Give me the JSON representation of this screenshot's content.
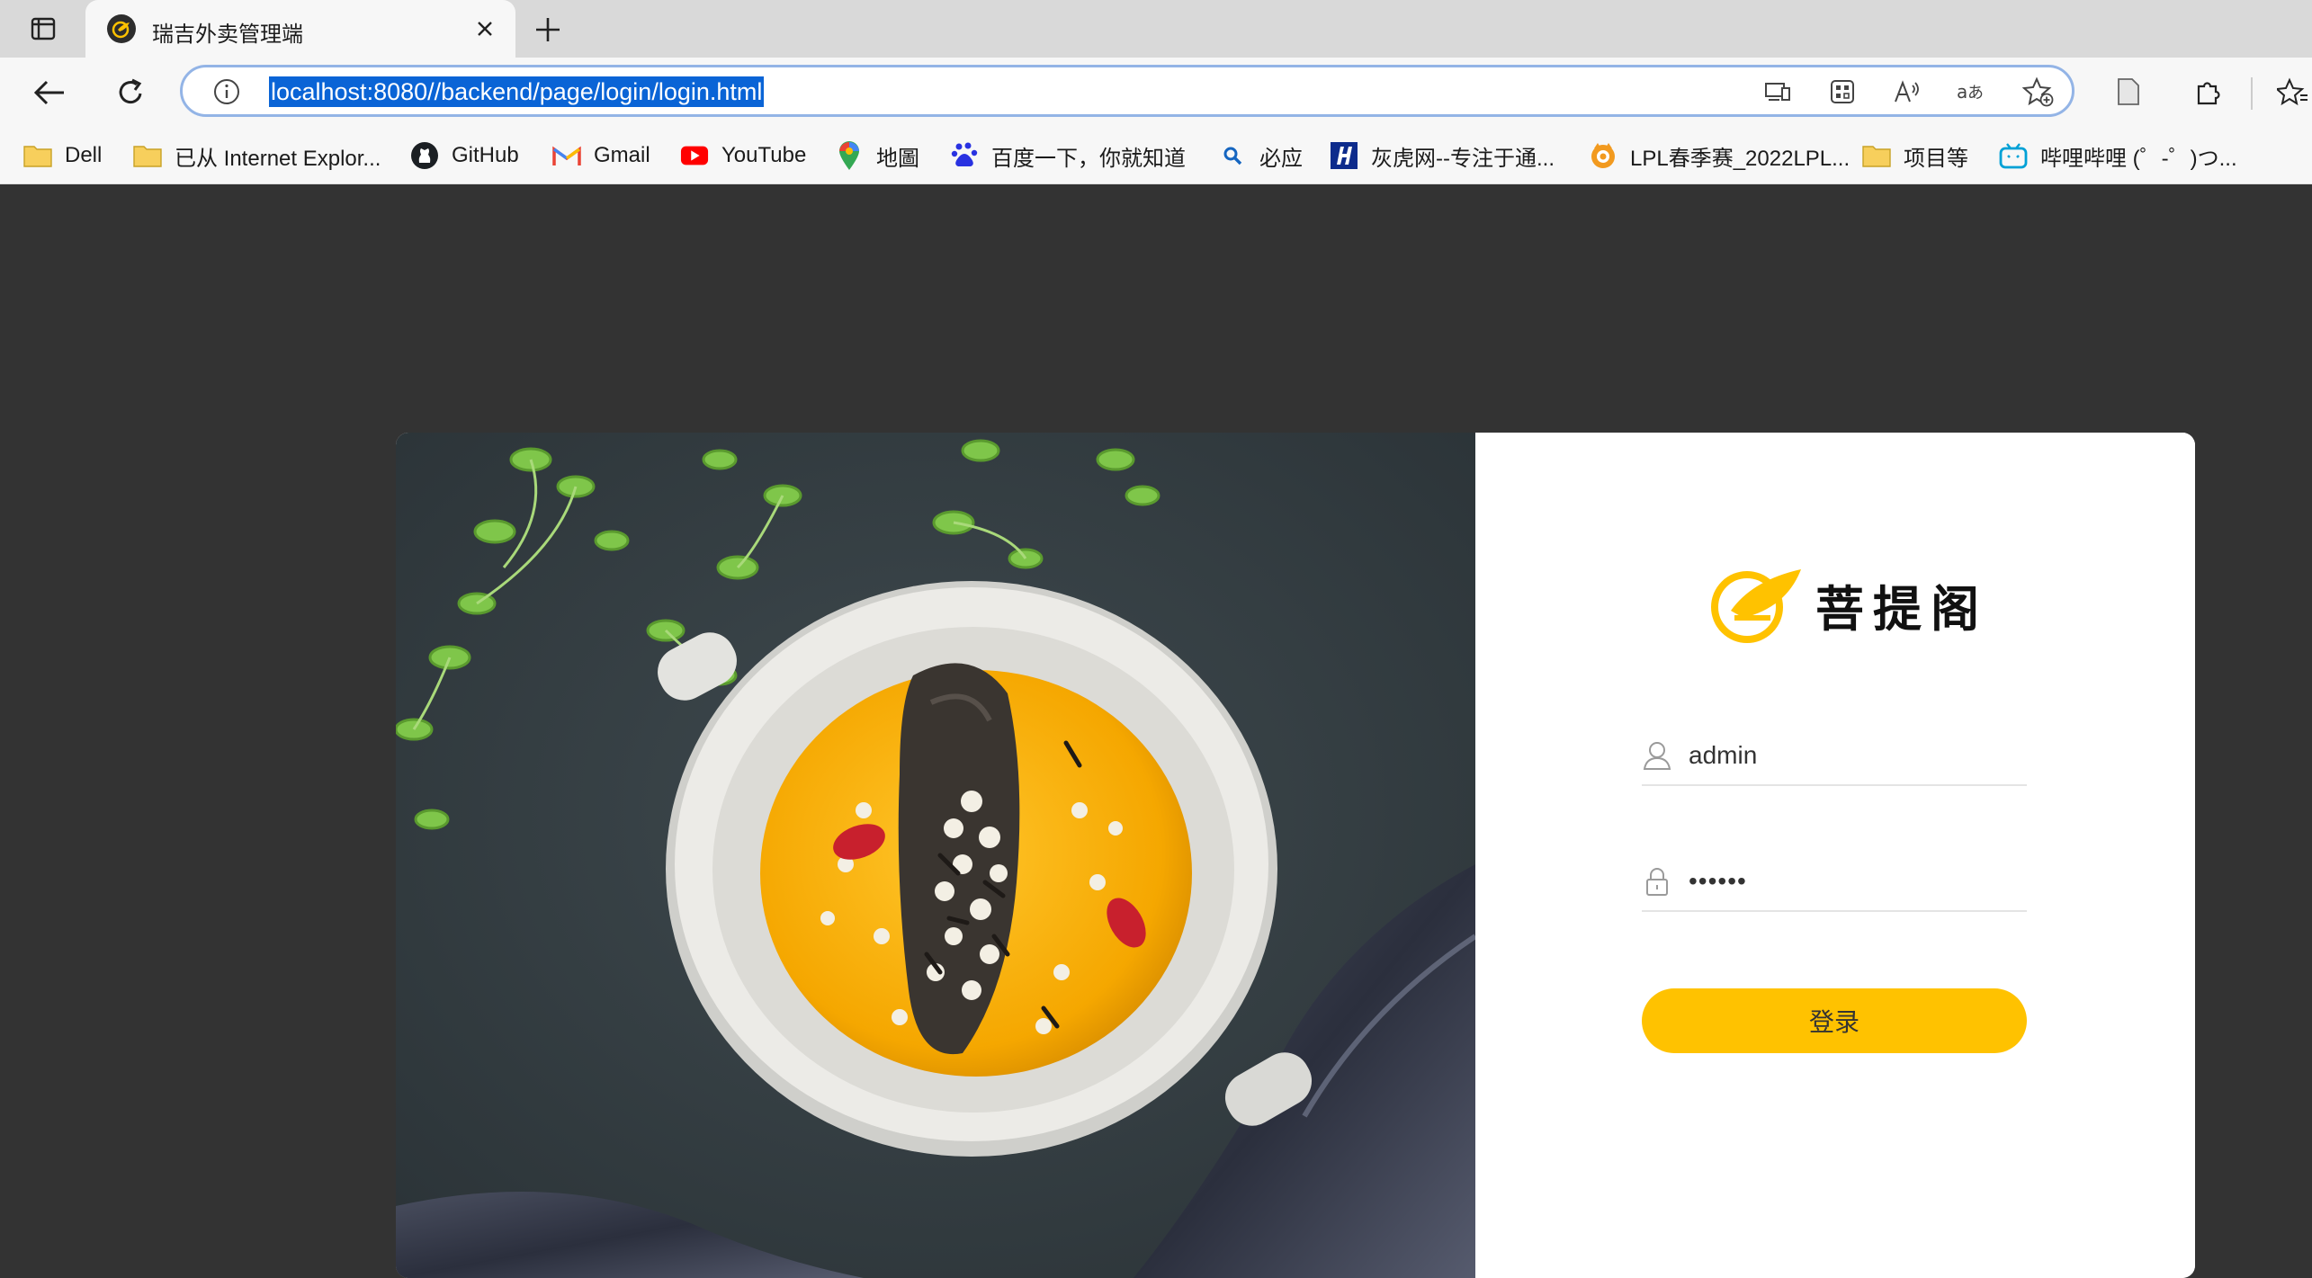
{
  "browser": {
    "tab": {
      "title": "瑞吉外卖管理端"
    },
    "address": {
      "url": "localhost:8080//backend/page/login/login.html"
    },
    "bookmarks": [
      {
        "label": "Dell",
        "icon": "folder-icon"
      },
      {
        "label": "已从 Internet Explor...",
        "icon": "folder-icon"
      },
      {
        "label": "GitHub",
        "icon": "github-icon"
      },
      {
        "label": "Gmail",
        "icon": "gmail-icon"
      },
      {
        "label": "YouTube",
        "icon": "youtube-icon"
      },
      {
        "label": "地圖",
        "icon": "maps-icon"
      },
      {
        "label": "百度一下，你就知道",
        "icon": "baidu-icon"
      },
      {
        "label": "必应",
        "icon": "bing-search-icon"
      },
      {
        "label": "灰虎网--专注于通...",
        "icon": "huihu-icon"
      },
      {
        "label": "LPL春季赛_2022LPL...",
        "icon": "lpl-icon"
      },
      {
        "label": "项目等",
        "icon": "folder-icon"
      },
      {
        "label": "哔哩哔哩 (゜-゜)つ...",
        "icon": "bilibili-icon"
      }
    ]
  },
  "login": {
    "brand_name": "菩提阁",
    "username": "admin",
    "password": "••••••",
    "submit_label": "登录"
  },
  "colors": {
    "accent": "#ffc200",
    "page_background": "#333333",
    "selection": "#0a64d6"
  }
}
